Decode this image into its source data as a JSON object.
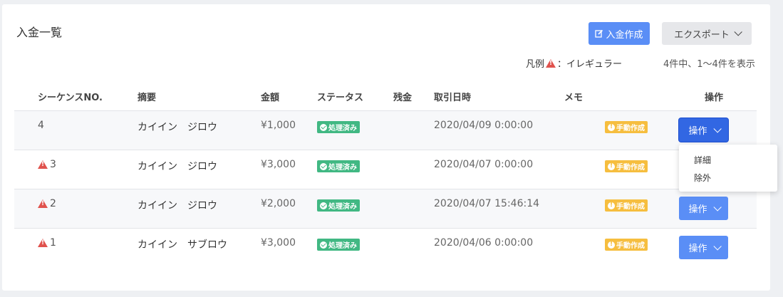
{
  "page": {
    "title": "入金一覧",
    "create_button": "入金作成",
    "export_button": "エクスポート",
    "legend_prefix": "凡例",
    "legend_text": "：イレギュラー",
    "count_text": "4件中、1〜4件を表示"
  },
  "table": {
    "headers": [
      "シーケンスNO.",
      "摘要",
      "金額",
      "ステータス",
      "残金",
      "取引日時",
      "メモ",
      "操作"
    ],
    "rows": [
      {
        "seq": "4",
        "irregular": false,
        "desc": "カイイン　ジロウ",
        "amount": "¥1,000",
        "status": "処理済み",
        "date": "2020/04/09 0:00:00",
        "memo": "手動作成",
        "op": "操作"
      },
      {
        "seq": "3",
        "irregular": true,
        "desc": "カイイン　ジロウ",
        "amount": "¥3,000",
        "status": "処理済み",
        "date": "2020/04/07 0:00:00",
        "memo": "手動作成",
        "op": "操作"
      },
      {
        "seq": "2",
        "irregular": true,
        "desc": "カイイン　ジロウ",
        "amount": "¥2,000",
        "status": "処理済み",
        "date": "2020/04/07 15:46:14",
        "memo": "手動作成",
        "op": "操作"
      },
      {
        "seq": "1",
        "irregular": true,
        "desc": "カイイン　サブロウ",
        "amount": "¥3,000",
        "status": "処理済み",
        "date": "2020/04/06 0:00:00",
        "memo": "手動作成",
        "op": "操作"
      }
    ]
  },
  "dropdown": {
    "items": [
      "詳細",
      "除外"
    ]
  },
  "colors": {
    "primary": "#5a8ef6",
    "primary_active": "#3267e3",
    "success": "#41b883",
    "warning": "#f6be3f",
    "danger": "#e0524d"
  }
}
